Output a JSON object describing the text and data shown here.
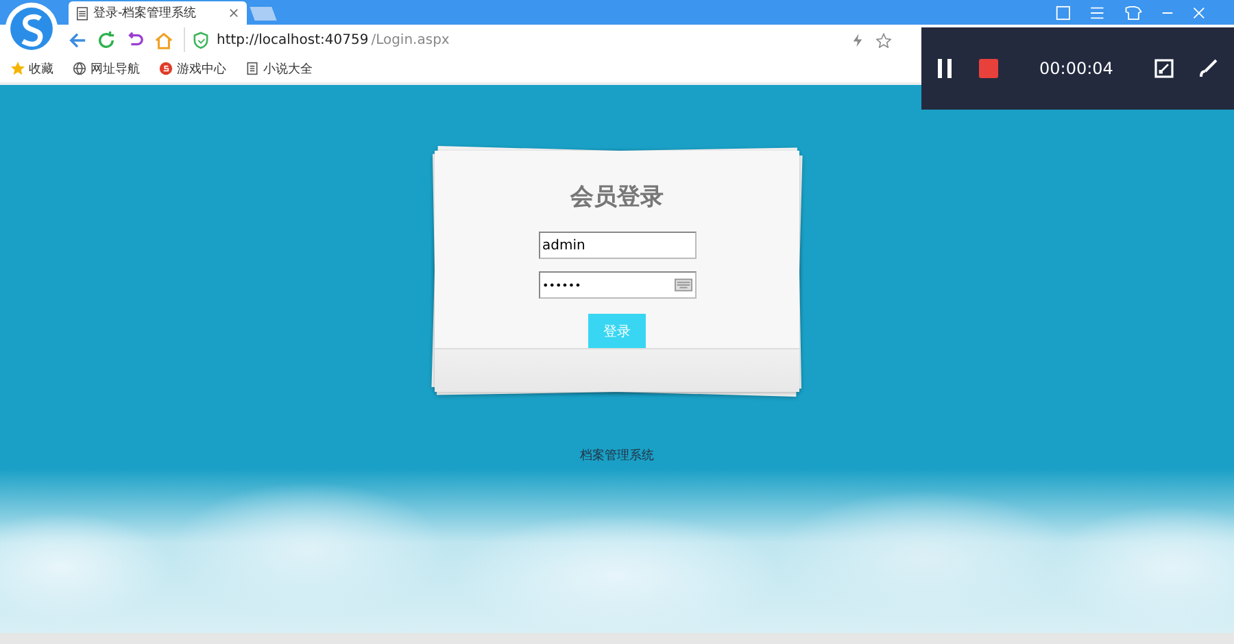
{
  "browser": {
    "tab_title": "登录-档案管理系统",
    "url_host": "http://localhost:40759",
    "url_path": "/Login.aspx",
    "bookmarks": [
      {
        "label": "收藏",
        "kind": "star"
      },
      {
        "label": "网址导航",
        "kind": "globe"
      },
      {
        "label": "游戏中心",
        "kind": "game"
      },
      {
        "label": "小说大全",
        "kind": "doc"
      }
    ]
  },
  "recorder": {
    "time": "00:00:04"
  },
  "login": {
    "title": "会员登录",
    "username": "admin",
    "password": "••••••",
    "button": "登录"
  },
  "footer": "档案管理系统"
}
